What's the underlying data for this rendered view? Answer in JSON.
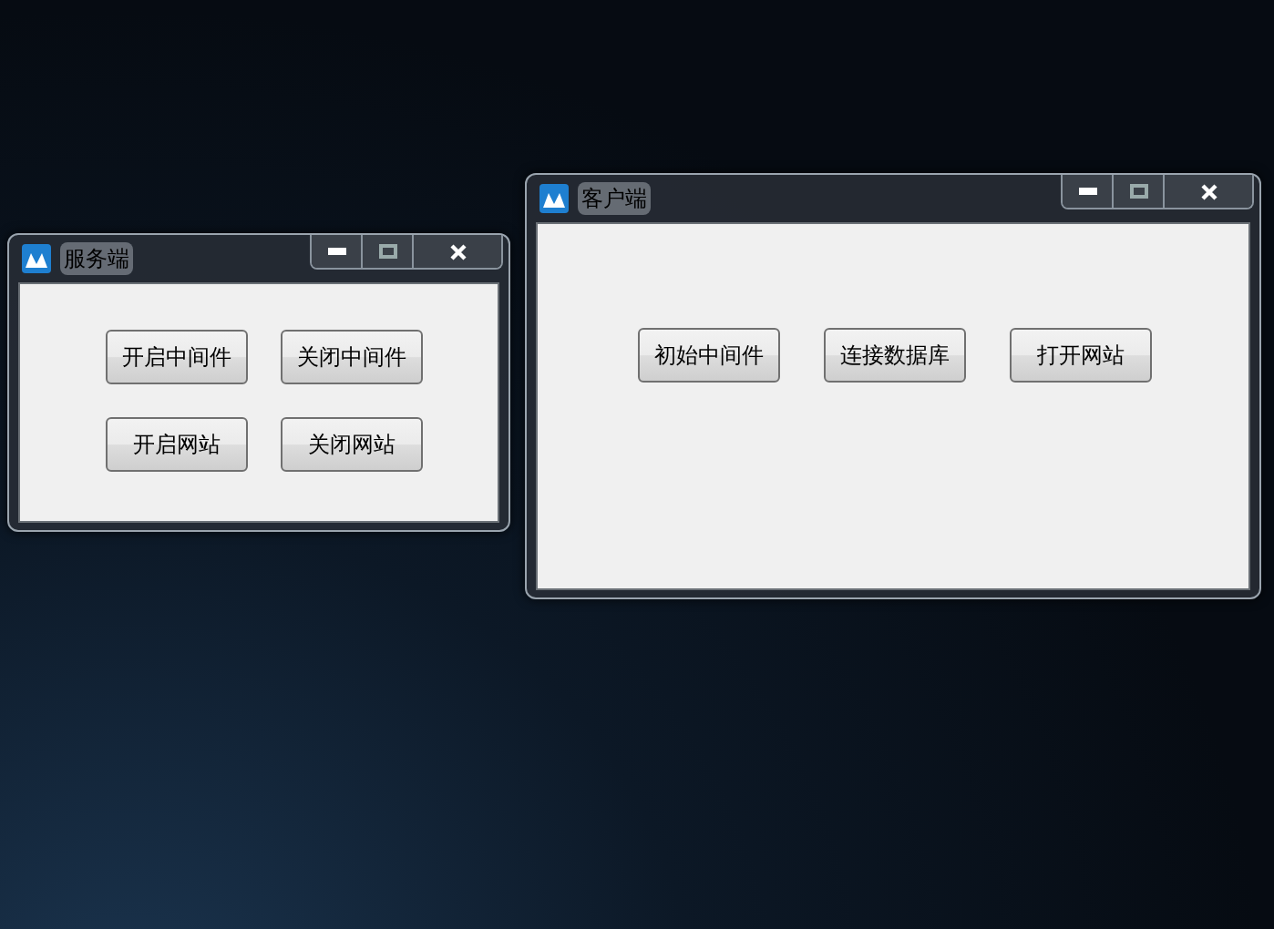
{
  "windows": [
    {
      "title": "服务端",
      "button_rows": [
        [
          "开启中间件",
          "关闭中间件"
        ],
        [
          "开启网站",
          "关闭网站"
        ]
      ]
    },
    {
      "title": "客户端",
      "button_rows": [
        [
          "初始中间件",
          "连接数据库",
          "打开网站"
        ]
      ]
    }
  ]
}
